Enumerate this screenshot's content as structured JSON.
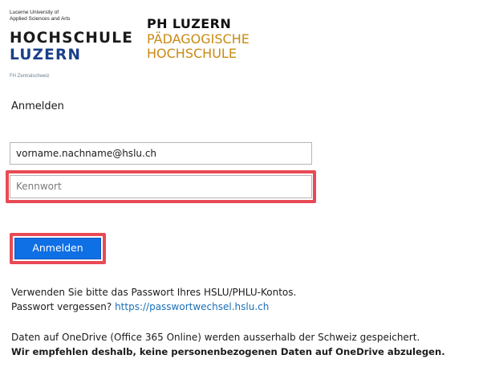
{
  "hslu_logo": {
    "line1": "Lucerne University of",
    "line2": "Applied Sciences and Arts",
    "word1": "HOCHSCHULE",
    "word2": "LUZERN",
    "footer": "FH Zentralschweiz",
    "colors": {
      "word1": "#1a1a1a",
      "word2": "#1a3f8a"
    }
  },
  "ph_logo": {
    "title": "PH LUZERN",
    "line1": "PÄDAGOGISCHE",
    "line2": "HOCHSCHULE",
    "colors": {
      "title": "#111111",
      "sub": "#c98a13"
    }
  },
  "form": {
    "heading": "Anmelden",
    "username_value": "vorname.nachname@hslu.ch",
    "password_placeholder": "Kennwort",
    "submit_label": "Anmelden"
  },
  "info": {
    "line1": "Verwenden Sie bitte das Passwort Ihres HSLU/PHLU-Kontos.",
    "forgot_label": "Passwort vergessen?",
    "forgot_link": "https://passwortwechsel.hslu.ch",
    "notice": "Daten auf OneDrive (Office 365 Online) werden ausserhalb der Schweiz gespeichert.",
    "warning": "Wir empfehlen deshalb, keine personenbezogenen Daten auf OneDrive abzulegen."
  },
  "theme": {
    "accent": "#0f6fe5",
    "highlight": "#e84a55",
    "link": "#1a6fb8"
  }
}
